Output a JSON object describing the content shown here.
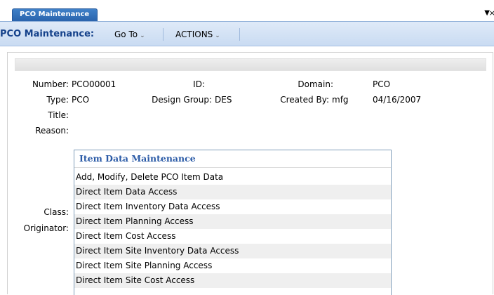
{
  "tab": {
    "label": "PCO Maintenance"
  },
  "toolbar": {
    "title": "PCO Maintenance:",
    "goto_label": "Go To",
    "actions_label": "ACTIONS"
  },
  "form": {
    "number_label": "Number:",
    "number_value": "PCO00001",
    "id_label": "ID:",
    "id_value": "",
    "domain_label": "Domain:",
    "domain_value": "PCO",
    "type_label": "Type:",
    "type_value": "PCO",
    "design_group_label": "Design Group:",
    "design_group_value": "DES",
    "created_by_label": "Created By:",
    "created_by_value": "mfg",
    "created_date": "04/16/2007",
    "title_label": "Title:",
    "reason_label": "Reason:",
    "class_label": "Class:",
    "originator_label": "Originator:"
  },
  "dropdown": {
    "header": "Item Data Maintenance",
    "items": [
      "Add, Modify, Delete PCO Item Data",
      "Direct Item Data Access",
      "Direct Item Inventory Data Access",
      "Direct Item Planning Access",
      "Direct Item Cost Access",
      "Direct Item Site Inventory Data Access",
      "Direct Item Site Planning Access",
      "Direct Item Site Cost Access"
    ]
  },
  "icons": {
    "tab_menu": "triangle-down-icon",
    "tab_close": "close-icon",
    "menu_chevron": "chevron-down-icon"
  }
}
